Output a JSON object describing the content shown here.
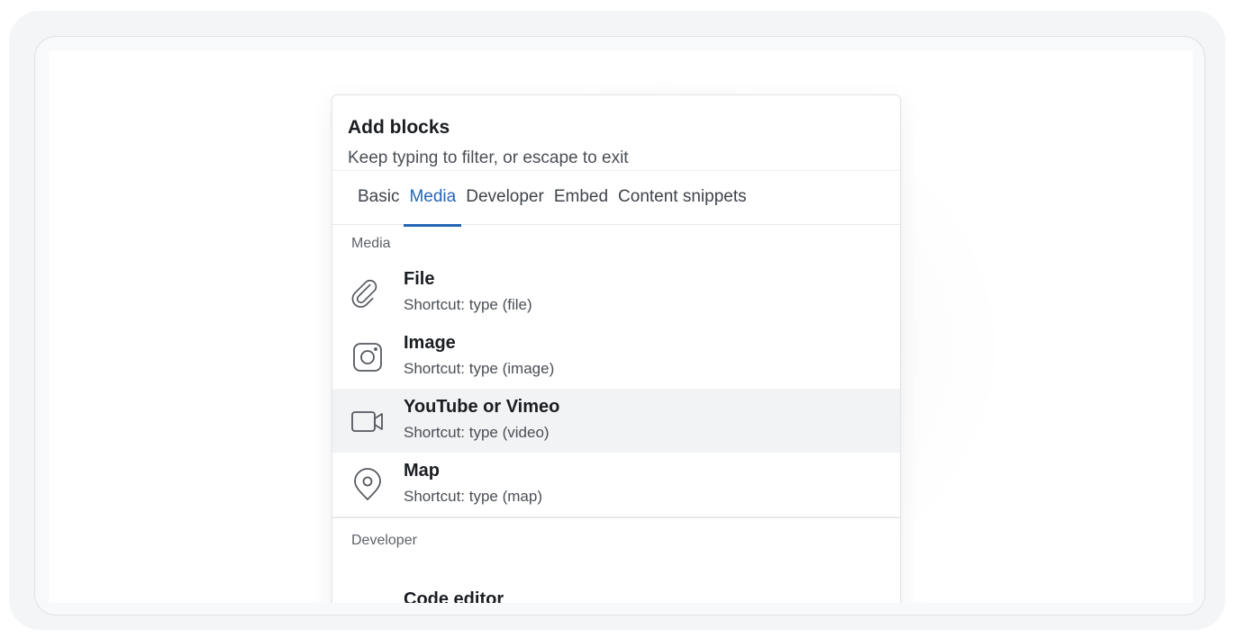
{
  "panel": {
    "title": "Add blocks",
    "subtitle": "Keep typing to filter, or escape to exit"
  },
  "tabs": [
    {
      "label": "Basic",
      "active": false
    },
    {
      "label": "Media",
      "active": true
    },
    {
      "label": "Developer",
      "active": false
    },
    {
      "label": "Embed",
      "active": false
    },
    {
      "label": "Content snippets",
      "active": false
    }
  ],
  "sections": {
    "media": {
      "label": "Media",
      "items": [
        {
          "title": "File",
          "shortcut": "Shortcut: type (file)",
          "icon": "paperclip-icon"
        },
        {
          "title": "Image",
          "shortcut": "Shortcut: type (image)",
          "icon": "image-icon"
        },
        {
          "title": "YouTube or Vimeo",
          "shortcut": "Shortcut: type (video)",
          "icon": "video-camera-icon",
          "highlighted": true
        },
        {
          "title": "Map",
          "shortcut": "Shortcut: type (map)",
          "icon": "map-pin-icon"
        }
      ]
    },
    "developer": {
      "label": "Developer",
      "items": [
        {
          "title": "Code editor"
        }
      ]
    }
  },
  "colors": {
    "accent": "#2466b5",
    "highlight_row": "#f1f3f5"
  }
}
